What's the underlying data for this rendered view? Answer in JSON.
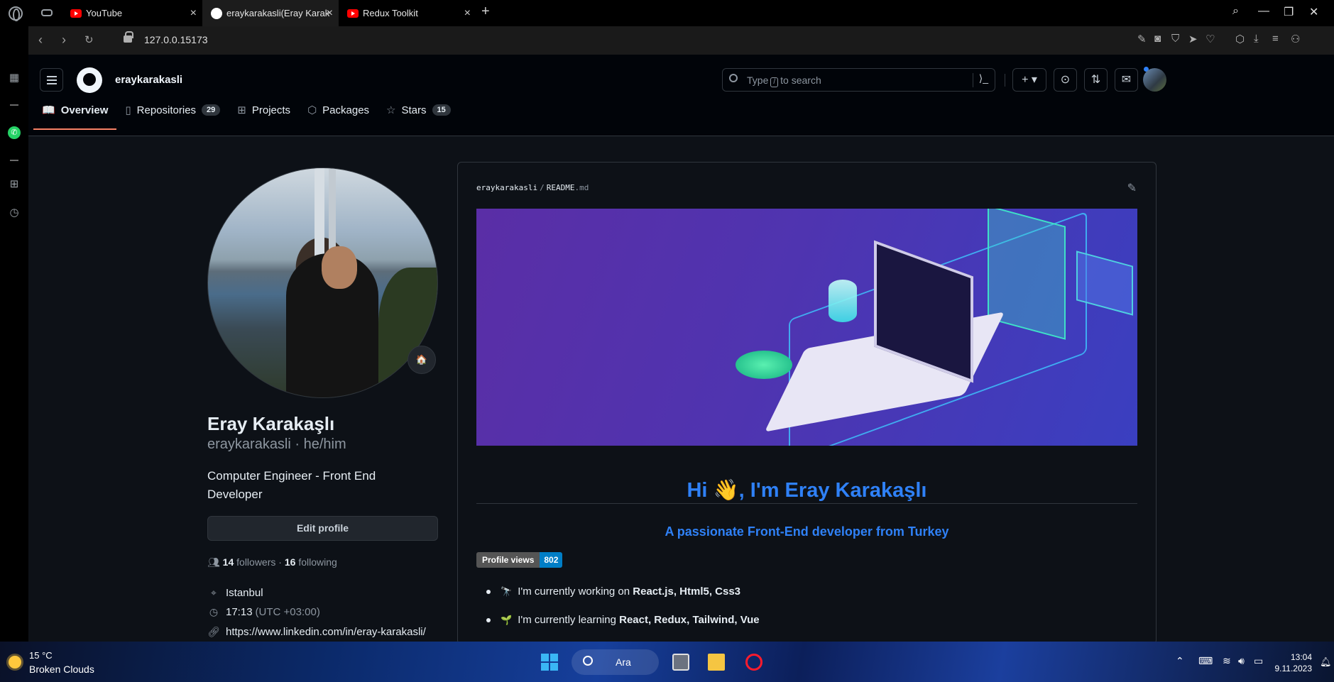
{
  "browser": {
    "tabs": [
      {
        "label": "YouTube",
        "favicon": "youtube-icon"
      },
      {
        "label": "eraykarakasli(Eray Karak",
        "favicon": "github-icon"
      },
      {
        "label": "Redux Toolkit",
        "favicon": "youtube-icon"
      }
    ],
    "url": "127.0.0.15173"
  },
  "github": {
    "username": "eraykarakasli",
    "search_prefix": "Type",
    "search_key": "/",
    "search_suffix": "to search",
    "tabs": [
      {
        "label": "Overview",
        "count": ""
      },
      {
        "label": "Repositories",
        "count": "29"
      },
      {
        "label": "Projects",
        "count": ""
      },
      {
        "label": "Packages",
        "count": ""
      },
      {
        "label": "Stars",
        "count": "15"
      }
    ]
  },
  "profile": {
    "name": "Eray Karakaşlı",
    "login": "eraykarakasli · he/him",
    "bio": "Computer Engineer - Front End Developer",
    "edit_label": "Edit profile",
    "followers": "14",
    "followers_label": "followers",
    "following": "16",
    "following_label": "following",
    "location": "Istanbul",
    "time": "17:13",
    "timezone": "(UTC +03:00)",
    "link": "https://www.linkedin.com/in/eray-karakasli/",
    "status_emoji": "🏠"
  },
  "readme": {
    "owner": "eraykarakasli",
    "file": "README",
    "ext": ".md",
    "heading": "Hi 👋, I'm Eray Karakaşlı",
    "subheading": "A passionate Front-End developer from Turkey",
    "badge_label": "Profile views",
    "badge_value": "802",
    "bullets": [
      {
        "emoji": "🔭",
        "text": "I'm currently working on ",
        "bold": "React.js, Html5, Css3"
      },
      {
        "emoji": "🌱",
        "text": "I'm currently learning ",
        "bold": "React, Redux, Tailwind, Vue"
      }
    ]
  },
  "taskbar": {
    "temp": "15 °C",
    "weather": "Broken Clouds",
    "search_label": "Ara",
    "time": "13:04",
    "date": "9.11.2023"
  },
  "colors": {
    "accent": "#2f81f7",
    "tab_underline": "#f78166",
    "bg": "#0d1117"
  }
}
